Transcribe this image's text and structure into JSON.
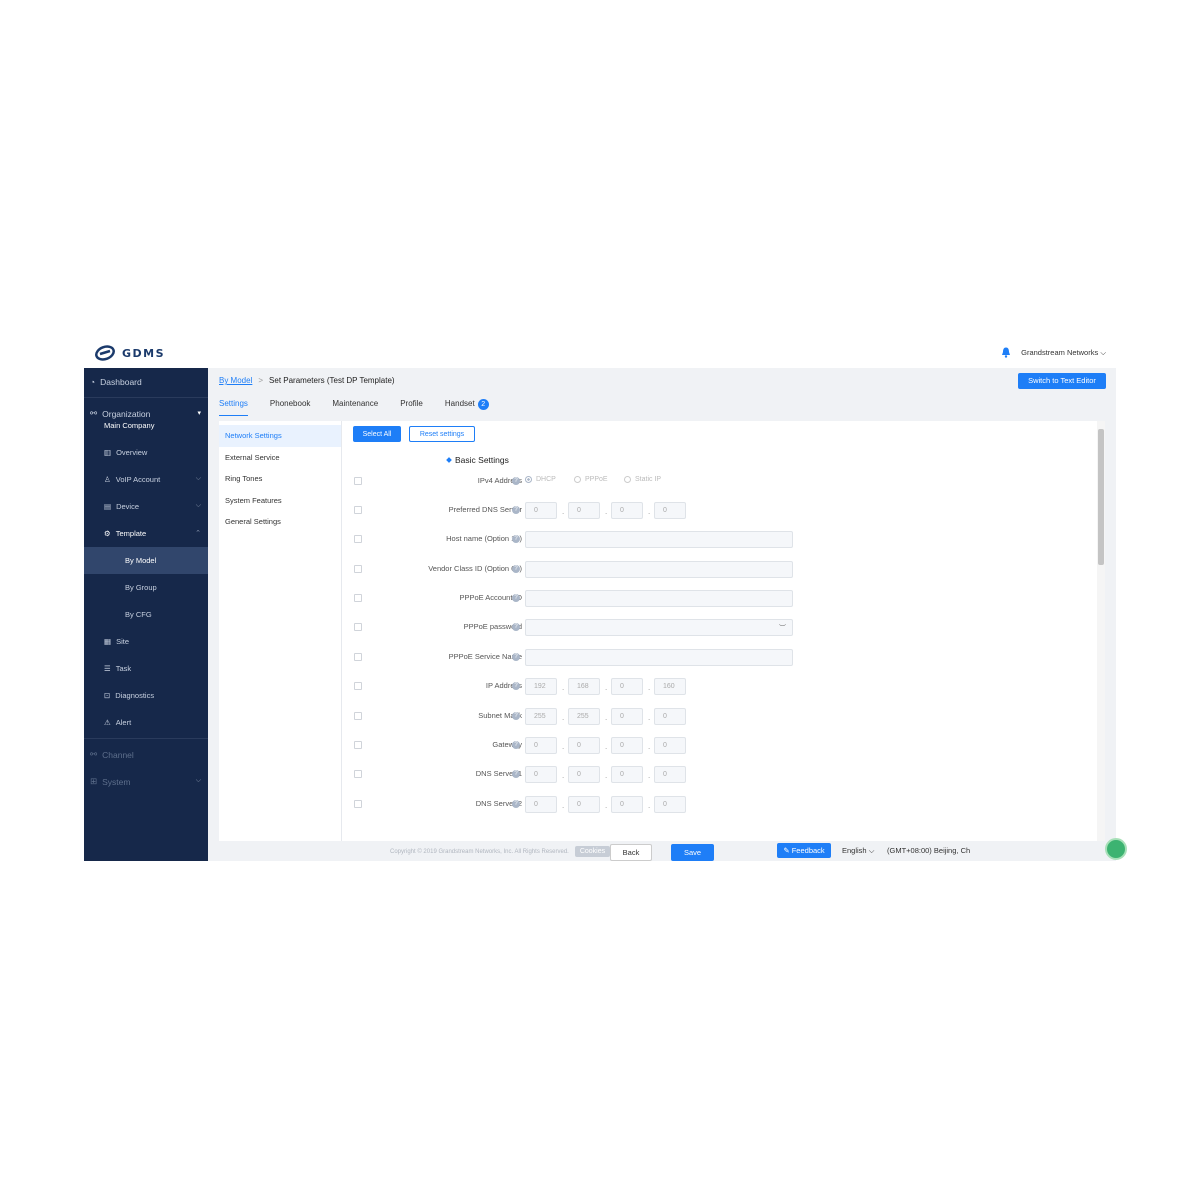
{
  "app": {
    "logo_text": "GDMS",
    "brand_color": "#1e7ef7",
    "sidebar_color": "#16284a"
  },
  "header": {
    "org_name": "Grandstream Networks",
    "bell_icon": "bell-icon"
  },
  "sidebar": {
    "dashboard": "Dashboard",
    "organization": "Organization",
    "company": "Main Company",
    "overview": "Overview",
    "voip": "VoIP Account",
    "device": "Device",
    "template": "Template",
    "by_model": "By Model",
    "by_group": "By Group",
    "by_cfg": "By CFG",
    "site": "Site",
    "task": "Task",
    "diagnostics": "Diagnostics",
    "alert": "Alert",
    "channel": "Channel",
    "system": "System"
  },
  "breadcrumb": {
    "parent": "By Model",
    "sep": ">",
    "current": "Set Parameters (Test DP Template)"
  },
  "switch_button": "Switch to Text Editor",
  "tabs": [
    {
      "label": "Settings"
    },
    {
      "label": "Phonebook"
    },
    {
      "label": "Maintenance"
    },
    {
      "label": "Profile"
    },
    {
      "label": "Handset",
      "badge": "2"
    }
  ],
  "left_menu": [
    "Network Settings",
    "External Service",
    "Ring Tones",
    "System Features",
    "General Settings"
  ],
  "actions": {
    "select_all": "Select All",
    "reset": "Reset settings"
  },
  "section_title": "Basic Settings",
  "fields": {
    "ipv4": {
      "label": "IPv4 Address",
      "options": [
        "DHCP",
        "PPPoE",
        "Static IP"
      ]
    },
    "dns_pref": {
      "label": "Preferred DNS Server",
      "values": [
        "0",
        "0",
        "0",
        "0"
      ]
    },
    "hostname": {
      "label": "Host name (Option 12)"
    },
    "vendor": {
      "label": "Vendor Class ID (Option 60)"
    },
    "pppoe_id": {
      "label": "PPPoE Account ID"
    },
    "pppoe_pw": {
      "label": "PPPoE password"
    },
    "pppoe_svc": {
      "label": "PPPoE Service Name"
    },
    "ip_addr": {
      "label": "IP Address",
      "values": [
        "192",
        "168",
        "0",
        "160"
      ]
    },
    "subnet": {
      "label": "Subnet Mask",
      "values": [
        "255",
        "255",
        "0",
        "0"
      ]
    },
    "gateway": {
      "label": "Gateway",
      "values": [
        "0",
        "0",
        "0",
        "0"
      ]
    },
    "dns1": {
      "label": "DNS Server 1",
      "values": [
        "0",
        "0",
        "0",
        "0"
      ]
    },
    "dns2": {
      "label": "DNS Server 2",
      "values": [
        "0",
        "0",
        "0",
        "0"
      ]
    }
  },
  "footer": {
    "back": "Back",
    "save": "Save",
    "copyright": "Copyright © 2019 Grandstream Networks, Inc. All Rights Reserved.",
    "cookies": "Cookies",
    "feedback": "Feedback",
    "language": "English",
    "timezone": "(GMT+08:00) Beijing, Ch"
  }
}
